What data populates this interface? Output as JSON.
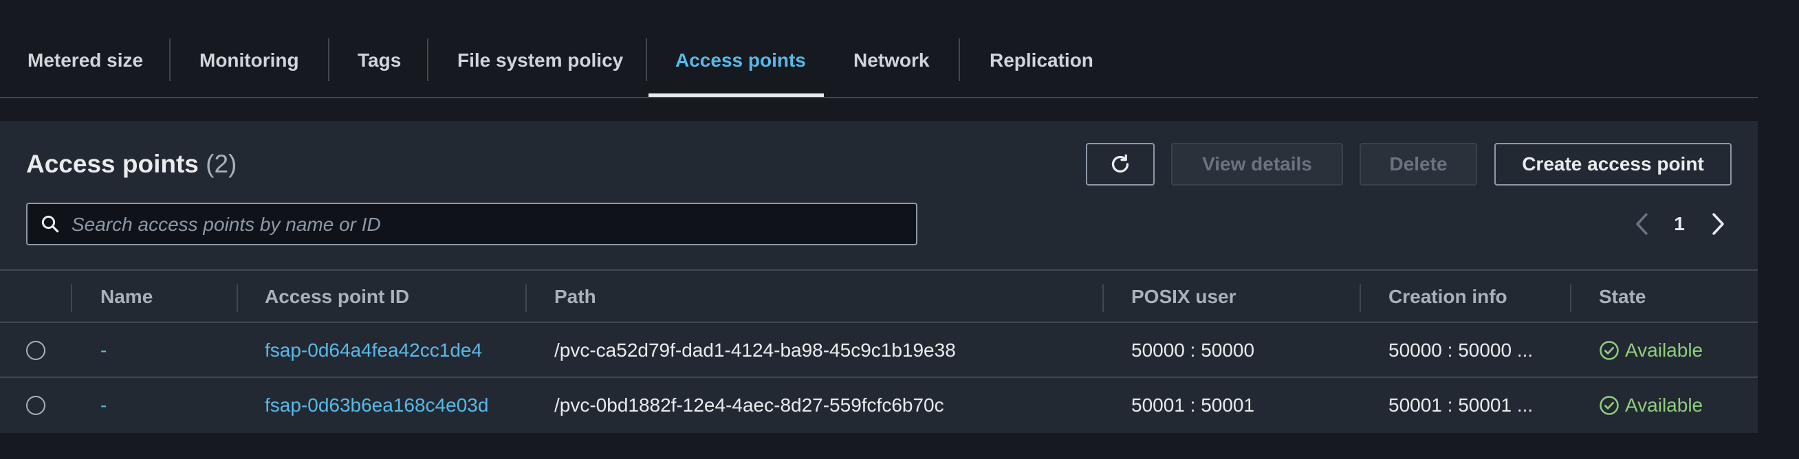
{
  "tabs": [
    {
      "label": "Metered size",
      "active": false
    },
    {
      "label": "Monitoring",
      "active": false
    },
    {
      "label": "Tags",
      "active": false
    },
    {
      "label": "File system policy",
      "active": false
    },
    {
      "label": "Access points",
      "active": true
    },
    {
      "label": "Network",
      "active": false
    },
    {
      "label": "Replication",
      "active": false
    }
  ],
  "panel": {
    "title": "Access points",
    "count": "(2)",
    "refresh_icon": "refresh-icon",
    "view_details_label": "View details",
    "delete_label": "Delete",
    "create_label": "Create access point"
  },
  "search": {
    "placeholder": "Search access points by name or ID",
    "value": ""
  },
  "pagination": {
    "current_page": "1"
  },
  "table": {
    "columns": [
      "Name",
      "Access point ID",
      "Path",
      "POSIX user",
      "Creation info",
      "State"
    ],
    "rows": [
      {
        "name": "-",
        "id": "fsap-0d64a4fea42cc1de4",
        "path": "/pvc-ca52d79f-dad1-4124-ba98-45c9c1b19e38",
        "posix_user": "50000 : 50000",
        "creation_info": "50000 : 50000 ...",
        "state": "Available"
      },
      {
        "name": "-",
        "id": "fsap-0d63b6ea168c4e03d",
        "path": "/pvc-0bd1882f-12e4-4aec-8d27-559fcfc6b70c",
        "posix_user": "50001 : 50001",
        "creation_info": "50001 : 50001 ...",
        "state": "Available"
      }
    ]
  },
  "colors": {
    "background": "#16191f",
    "panel": "#232932",
    "accent": "#59b9e8",
    "success": "#8fce7c"
  }
}
